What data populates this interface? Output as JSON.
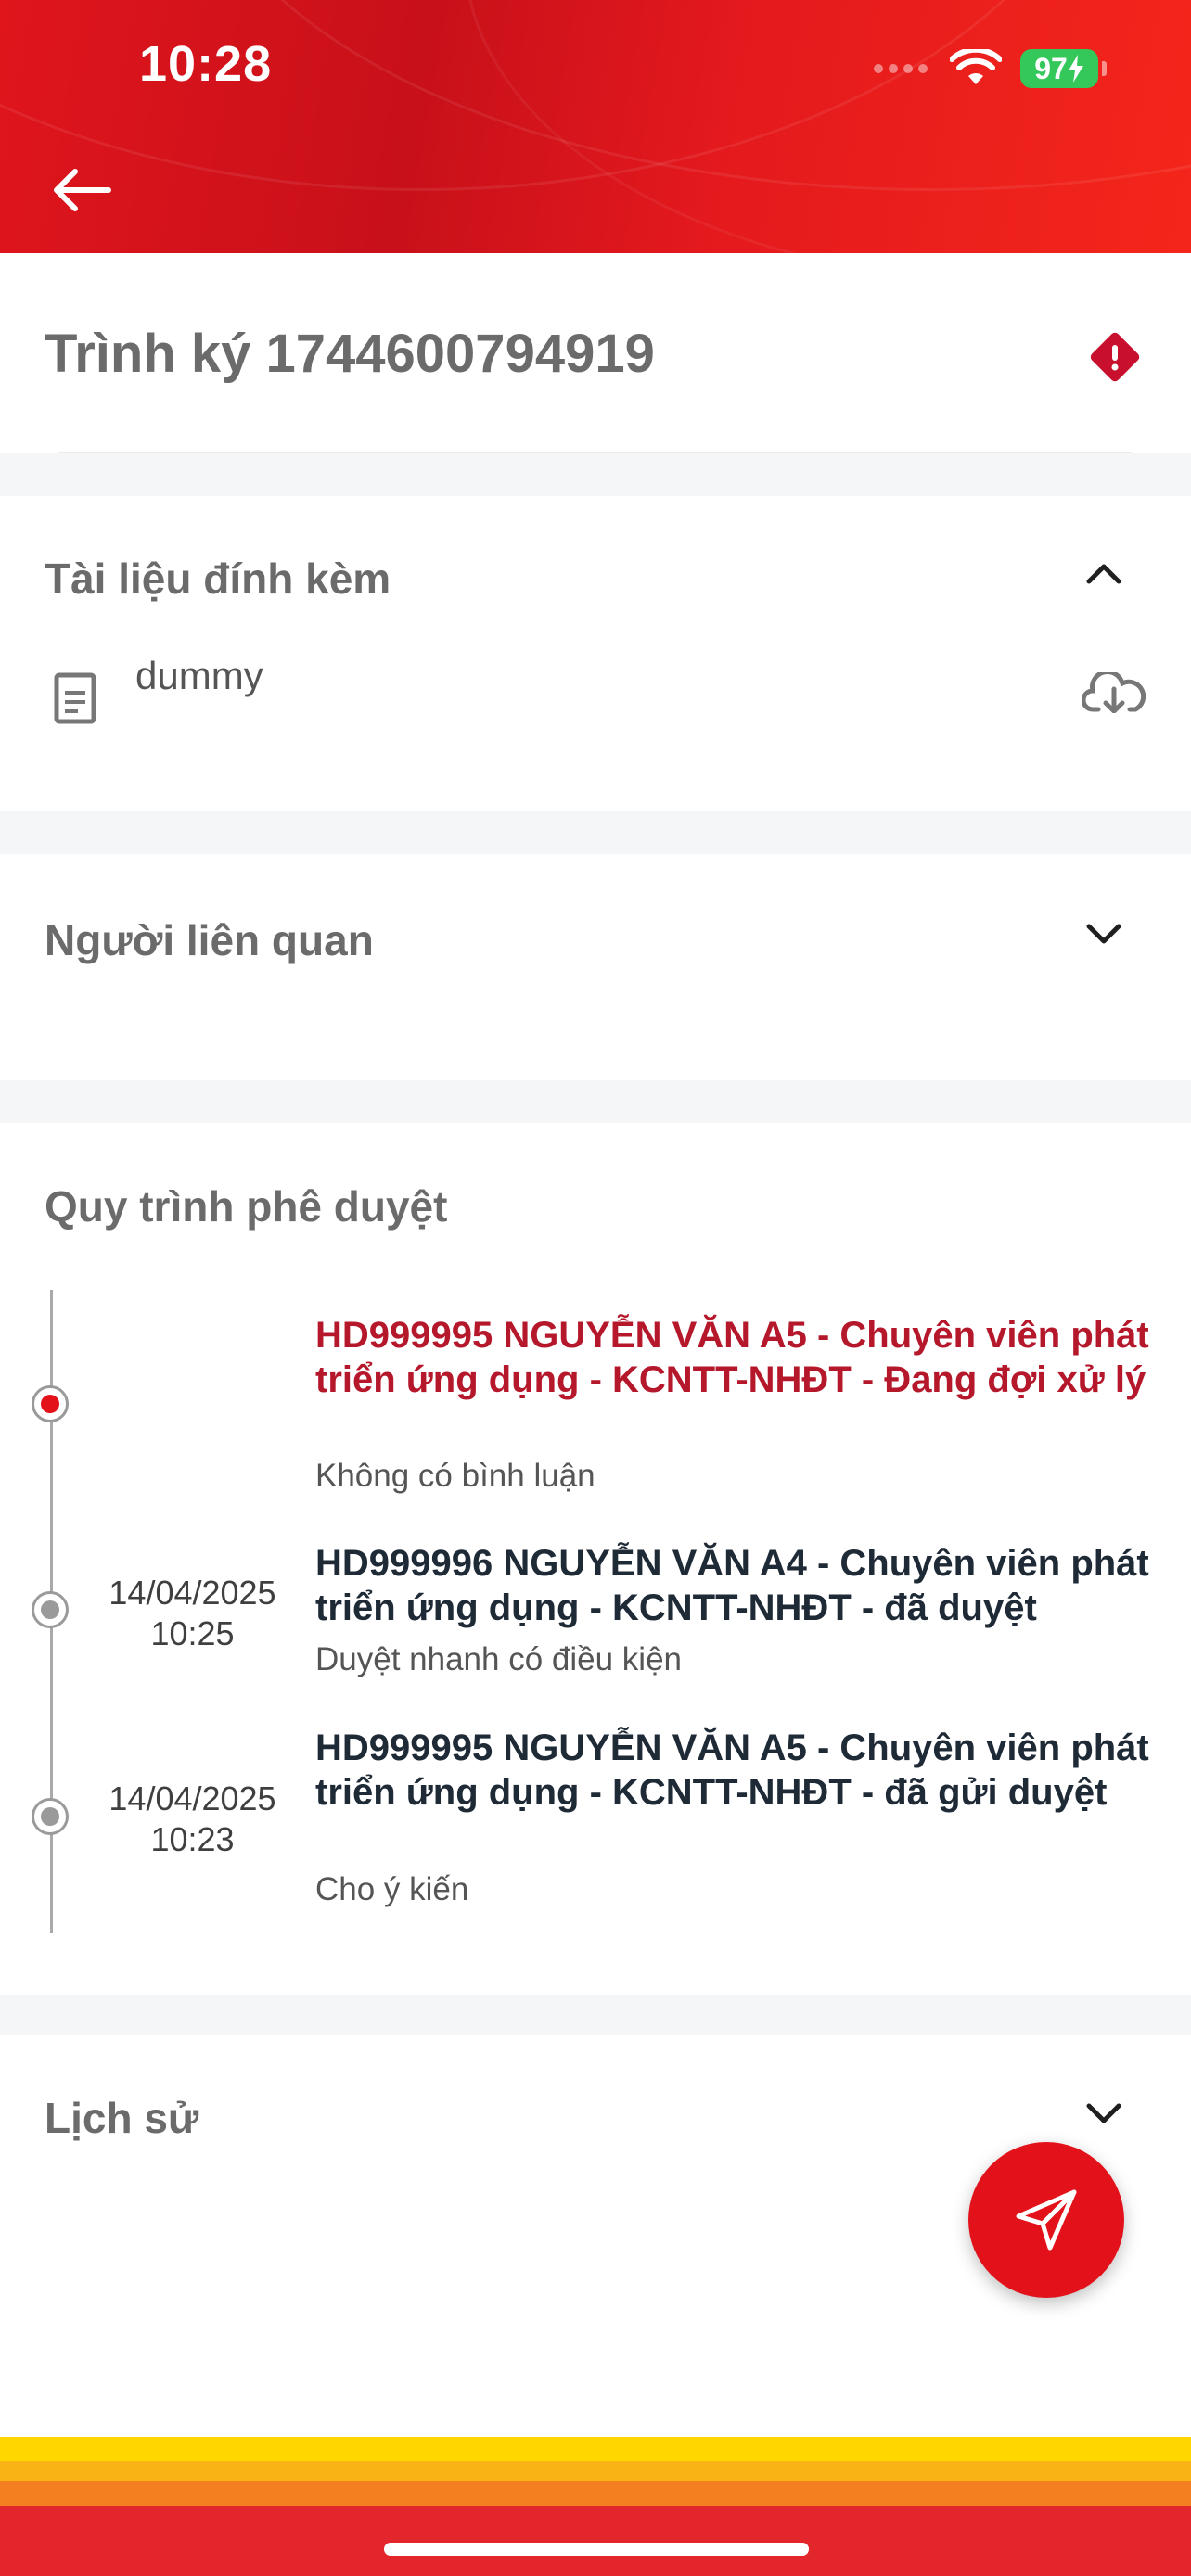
{
  "status_bar": {
    "time": "10:28",
    "battery": "97"
  },
  "header": {
    "back_icon": "arrow-left-icon"
  },
  "document": {
    "title": "Trình ký 1744600794919",
    "alert_icon": "diamond-alert-icon",
    "alert_color": "#c8102e"
  },
  "attachments": {
    "title": "Tài liệu đính kèm",
    "expanded": true,
    "items": [
      {
        "name": "dummy",
        "icon": "file-icon",
        "action_icon": "download-icon"
      }
    ]
  },
  "related_people": {
    "title": "Người liên quan",
    "expanded": false
  },
  "approval_process": {
    "title": "Quy trình phê duyệt",
    "steps": [
      {
        "date": "",
        "time": "",
        "title": "HD999995 NGUYỄN VĂN A5 - Chuyên viên phát triển ứng dụng - KCNTT-NHĐT - Đang đợi xử lý",
        "comment": "Không có bình luận",
        "status": "pending"
      },
      {
        "date": "14/04/2025",
        "time": "10:25",
        "title": "HD999996 NGUYỄN VĂN A4 - Chuyên viên phát triển ứng dụng - KCNTT-NHĐT - đã duyệt",
        "comment": "Duyệt nhanh có điều kiện",
        "status": "done"
      },
      {
        "date": "14/04/2025",
        "time": "10:23",
        "title": "HD999995 NGUYỄN VĂN A5 - Chuyên viên phát triển ứng dụng - KCNTT-NHĐT - đã gửi duyệt",
        "comment": "Cho ý kiến",
        "status": "done"
      }
    ]
  },
  "history": {
    "title": "Lịch sử",
    "expanded": false
  },
  "fab": {
    "icon": "send-icon",
    "color": "#e3121a"
  },
  "colors": {
    "brand_red": "#e3121a",
    "pending_text": "#b5172b",
    "footer_yellow": "#ffd600",
    "footer_orange": "#f7931e",
    "footer_red": "#e3262b"
  }
}
